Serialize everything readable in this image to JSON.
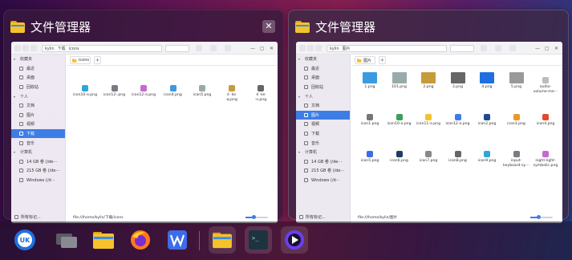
{
  "windows": [
    {
      "title": "文件管理器",
      "path_user": "kylin",
      "path_folder": "下载",
      "path_tail": "icons",
      "tab_label": "icons",
      "sidebar": [
        {
          "label": "收藏夹",
          "group": true
        },
        {
          "label": "最近"
        },
        {
          "label": "桌面"
        },
        {
          "label": "回收站"
        },
        {
          "label": "个人",
          "group": true
        },
        {
          "label": "文档"
        },
        {
          "label": "图片"
        },
        {
          "label": "视频"
        },
        {
          "label": "下载",
          "selected": true
        },
        {
          "label": "音乐"
        },
        {
          "label": "计算机",
          "group": true
        },
        {
          "label": "14 GB 卷 (/de⋯"
        },
        {
          "label": "215 GB 卷 (/de⋯"
        },
        {
          "label": "Windows (/d⋯"
        }
      ],
      "sidebar_footer": "所有标记...",
      "files": [
        "icon10-o.png",
        "icon12-.png",
        "icon12-o.png",
        "icon4.png",
        "icon5.png",
        "é  ·ke\n-q.png",
        "é  ·ke\n-s.png"
      ],
      "status": "file:///home/kylin/下载/icons",
      "zoom_fraction": 0.35
    },
    {
      "title": "文件管理器",
      "path_user": "kylin",
      "path_folder": "图片",
      "path_tail": "",
      "tab_label": "图片",
      "sidebar": [
        {
          "label": "收藏夹",
          "group": true
        },
        {
          "label": "最近"
        },
        {
          "label": "桌面"
        },
        {
          "label": "回收站"
        },
        {
          "label": "个人",
          "group": true
        },
        {
          "label": "文档"
        },
        {
          "label": "图片",
          "selected": true
        },
        {
          "label": "视频"
        },
        {
          "label": "下载"
        },
        {
          "label": "音乐"
        },
        {
          "label": "计算机",
          "group": true
        },
        {
          "label": "14 GB 卷 (/de⋯"
        },
        {
          "label": "215 GB 卷 (/de⋯"
        },
        {
          "label": "Windows (/d⋯"
        }
      ],
      "sidebar_footer": "所有标记...",
      "files": [
        "1.png",
        "101.png",
        "2.png",
        "3.png",
        "4.png",
        "5.png",
        "audio-\nvolume-me⋯",
        "icon1.png",
        "icon10-o.png",
        "icon11-o.png",
        "icon12-o.png",
        "icon2.png",
        "icon3.png",
        "icon4.png",
        "icon5.png",
        "icon6.png",
        "icon7.png",
        "icon8.png",
        "icon9.png",
        "input-\nkeyboard-sy⋯",
        "night-light-\nsymbolic.png"
      ],
      "status": "file:///home/kylin/图片",
      "zoom_fraction": 0.35
    }
  ],
  "dock": [
    {
      "name": "kylin-start-icon",
      "color": "#1f6fe0"
    },
    {
      "name": "multitask-view-icon",
      "color": "#6a6a72"
    },
    {
      "name": "file-manager-icon",
      "color": "#f6c22b"
    },
    {
      "name": "firefox-icon",
      "color": "#ff7a1a"
    },
    {
      "name": "wps-writer-icon",
      "color": "#3d6ce8"
    },
    {
      "name": "file-manager-running-icon",
      "color": "#f6c22b"
    },
    {
      "name": "terminal-icon",
      "color": "#1d3440"
    },
    {
      "name": "video-player-icon",
      "color": "#6b3ff0"
    }
  ]
}
